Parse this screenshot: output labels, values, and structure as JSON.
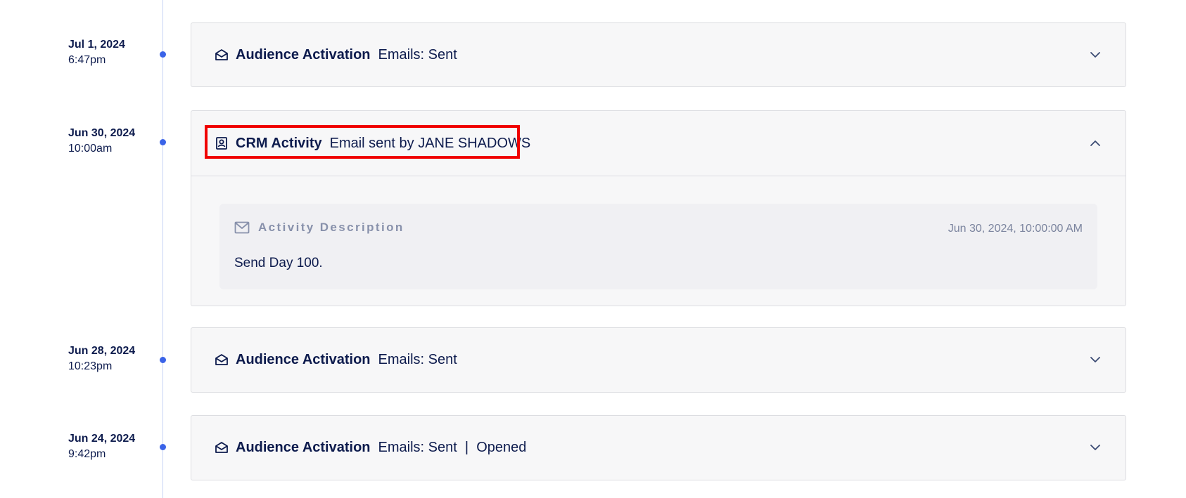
{
  "timeline": [
    {
      "date": "Jul 1, 2024",
      "time": "6:47pm",
      "category": "Audience Activation",
      "summary": "Emails: Sent",
      "icon": "envelope-open-icon",
      "expanded": false
    },
    {
      "date": "Jun 30, 2024",
      "time": "10:00am",
      "category": "CRM Activity",
      "summary": "Email sent by JANE SHADOWS",
      "icon": "contact-card-icon",
      "expanded": true,
      "highlighted": true,
      "details": {
        "label": "Activity Description",
        "timestamp": "Jun 30, 2024, 10:00:00 AM",
        "text": "Send Day 100.",
        "icon": "mail-icon"
      }
    },
    {
      "date": "Jun 28, 2024",
      "time": "10:23pm",
      "category": "Audience Activation",
      "summary": "Emails: Sent",
      "icon": "envelope-open-icon",
      "expanded": false
    },
    {
      "date": "Jun 24, 2024",
      "time": "9:42pm",
      "category": "Audience Activation",
      "summary": "Emails: Sent  |  Opened",
      "icon": "envelope-open-icon",
      "expanded": false
    }
  ],
  "colors": {
    "accent": "#3a63e8",
    "highlight": "#f00000",
    "text": "#0d1b4d",
    "muted": "#8891ab",
    "card_bg": "#f7f7f8",
    "panel_bg": "#f0f0f3"
  }
}
